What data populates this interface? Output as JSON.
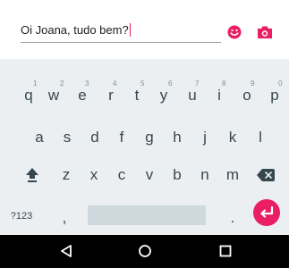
{
  "compose": {
    "text": "Oi Joana, tudo bem?",
    "accent": "#e91e63"
  },
  "icons": {
    "emoji": "emoji-icon",
    "camera": "camera-icon",
    "shift": "shift-icon",
    "backspace": "backspace-icon",
    "enter": "enter-icon",
    "back": "back-triangle-icon",
    "home": "home-circle-icon",
    "recents": "recents-square-icon"
  },
  "keyboard": {
    "row1": [
      "q",
      "w",
      "e",
      "r",
      "t",
      "y",
      "u",
      "i",
      "o",
      "p"
    ],
    "row1_hints": [
      "1",
      "2",
      "3",
      "4",
      "5",
      "6",
      "7",
      "8",
      "9",
      "0"
    ],
    "row2": [
      "a",
      "s",
      "d",
      "f",
      "g",
      "h",
      "j",
      "k",
      "l"
    ],
    "row3": [
      "z",
      "x",
      "c",
      "v",
      "b",
      "n",
      "m"
    ],
    "symbols_key": "?123",
    "comma_key": ",",
    "period_key": "."
  },
  "colors": {
    "keyboard_bg": "#eceff1",
    "key_text": "#37474f",
    "enter_bg": "#e91e63",
    "nav_bg": "#000000"
  }
}
